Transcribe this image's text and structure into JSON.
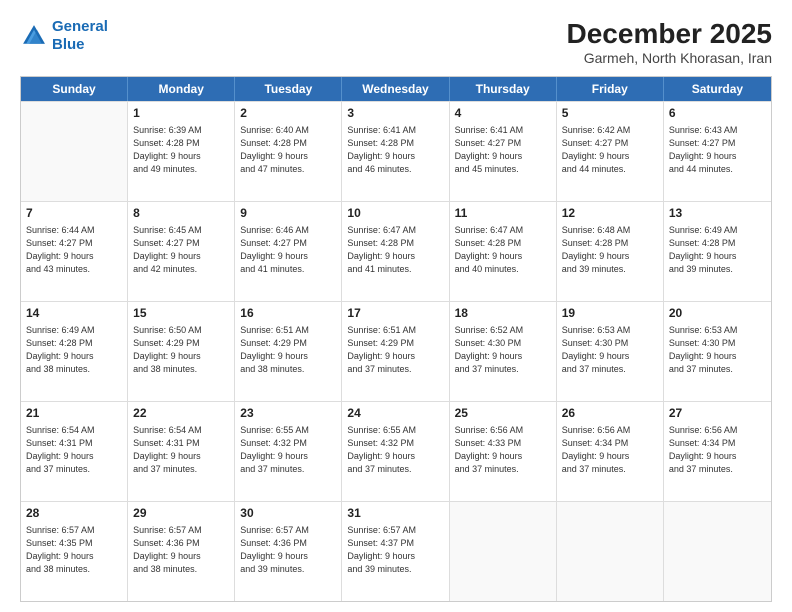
{
  "header": {
    "logo_line1": "General",
    "logo_line2": "Blue",
    "title": "December 2025",
    "subtitle": "Garmeh, North Khorasan, Iran"
  },
  "weekdays": [
    "Sunday",
    "Monday",
    "Tuesday",
    "Wednesday",
    "Thursday",
    "Friday",
    "Saturday"
  ],
  "rows": [
    [
      {
        "day": "",
        "info": ""
      },
      {
        "day": "1",
        "info": "Sunrise: 6:39 AM\nSunset: 4:28 PM\nDaylight: 9 hours\nand 49 minutes."
      },
      {
        "day": "2",
        "info": "Sunrise: 6:40 AM\nSunset: 4:28 PM\nDaylight: 9 hours\nand 47 minutes."
      },
      {
        "day": "3",
        "info": "Sunrise: 6:41 AM\nSunset: 4:28 PM\nDaylight: 9 hours\nand 46 minutes."
      },
      {
        "day": "4",
        "info": "Sunrise: 6:41 AM\nSunset: 4:27 PM\nDaylight: 9 hours\nand 45 minutes."
      },
      {
        "day": "5",
        "info": "Sunrise: 6:42 AM\nSunset: 4:27 PM\nDaylight: 9 hours\nand 44 minutes."
      },
      {
        "day": "6",
        "info": "Sunrise: 6:43 AM\nSunset: 4:27 PM\nDaylight: 9 hours\nand 44 minutes."
      }
    ],
    [
      {
        "day": "7",
        "info": "Sunrise: 6:44 AM\nSunset: 4:27 PM\nDaylight: 9 hours\nand 43 minutes."
      },
      {
        "day": "8",
        "info": "Sunrise: 6:45 AM\nSunset: 4:27 PM\nDaylight: 9 hours\nand 42 minutes."
      },
      {
        "day": "9",
        "info": "Sunrise: 6:46 AM\nSunset: 4:27 PM\nDaylight: 9 hours\nand 41 minutes."
      },
      {
        "day": "10",
        "info": "Sunrise: 6:47 AM\nSunset: 4:28 PM\nDaylight: 9 hours\nand 41 minutes."
      },
      {
        "day": "11",
        "info": "Sunrise: 6:47 AM\nSunset: 4:28 PM\nDaylight: 9 hours\nand 40 minutes."
      },
      {
        "day": "12",
        "info": "Sunrise: 6:48 AM\nSunset: 4:28 PM\nDaylight: 9 hours\nand 39 minutes."
      },
      {
        "day": "13",
        "info": "Sunrise: 6:49 AM\nSunset: 4:28 PM\nDaylight: 9 hours\nand 39 minutes."
      }
    ],
    [
      {
        "day": "14",
        "info": "Sunrise: 6:49 AM\nSunset: 4:28 PM\nDaylight: 9 hours\nand 38 minutes."
      },
      {
        "day": "15",
        "info": "Sunrise: 6:50 AM\nSunset: 4:29 PM\nDaylight: 9 hours\nand 38 minutes."
      },
      {
        "day": "16",
        "info": "Sunrise: 6:51 AM\nSunset: 4:29 PM\nDaylight: 9 hours\nand 38 minutes."
      },
      {
        "day": "17",
        "info": "Sunrise: 6:51 AM\nSunset: 4:29 PM\nDaylight: 9 hours\nand 37 minutes."
      },
      {
        "day": "18",
        "info": "Sunrise: 6:52 AM\nSunset: 4:30 PM\nDaylight: 9 hours\nand 37 minutes."
      },
      {
        "day": "19",
        "info": "Sunrise: 6:53 AM\nSunset: 4:30 PM\nDaylight: 9 hours\nand 37 minutes."
      },
      {
        "day": "20",
        "info": "Sunrise: 6:53 AM\nSunset: 4:30 PM\nDaylight: 9 hours\nand 37 minutes."
      }
    ],
    [
      {
        "day": "21",
        "info": "Sunrise: 6:54 AM\nSunset: 4:31 PM\nDaylight: 9 hours\nand 37 minutes."
      },
      {
        "day": "22",
        "info": "Sunrise: 6:54 AM\nSunset: 4:31 PM\nDaylight: 9 hours\nand 37 minutes."
      },
      {
        "day": "23",
        "info": "Sunrise: 6:55 AM\nSunset: 4:32 PM\nDaylight: 9 hours\nand 37 minutes."
      },
      {
        "day": "24",
        "info": "Sunrise: 6:55 AM\nSunset: 4:32 PM\nDaylight: 9 hours\nand 37 minutes."
      },
      {
        "day": "25",
        "info": "Sunrise: 6:56 AM\nSunset: 4:33 PM\nDaylight: 9 hours\nand 37 minutes."
      },
      {
        "day": "26",
        "info": "Sunrise: 6:56 AM\nSunset: 4:34 PM\nDaylight: 9 hours\nand 37 minutes."
      },
      {
        "day": "27",
        "info": "Sunrise: 6:56 AM\nSunset: 4:34 PM\nDaylight: 9 hours\nand 37 minutes."
      }
    ],
    [
      {
        "day": "28",
        "info": "Sunrise: 6:57 AM\nSunset: 4:35 PM\nDaylight: 9 hours\nand 38 minutes."
      },
      {
        "day": "29",
        "info": "Sunrise: 6:57 AM\nSunset: 4:36 PM\nDaylight: 9 hours\nand 38 minutes."
      },
      {
        "day": "30",
        "info": "Sunrise: 6:57 AM\nSunset: 4:36 PM\nDaylight: 9 hours\nand 39 minutes."
      },
      {
        "day": "31",
        "info": "Sunrise: 6:57 AM\nSunset: 4:37 PM\nDaylight: 9 hours\nand 39 minutes."
      },
      {
        "day": "",
        "info": ""
      },
      {
        "day": "",
        "info": ""
      },
      {
        "day": "",
        "info": ""
      }
    ]
  ]
}
